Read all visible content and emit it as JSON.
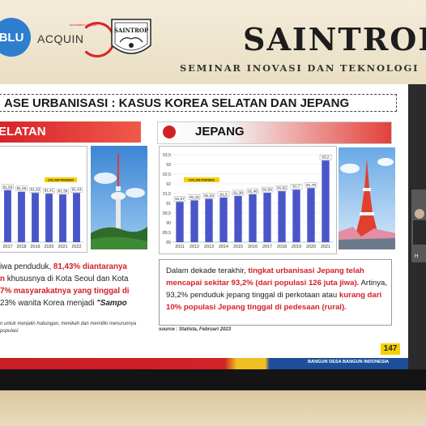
{
  "header": {
    "logo_blu": "BLU",
    "logo_acquin": "ACQUIN",
    "logo_acquin_small": "accredited program",
    "logo_saintrop": "SAINTROP",
    "title": "SAINTROP",
    "subtitle": "SEMINAR INOVASI DAN TEKNOLOGI"
  },
  "slide": {
    "title": "ASE URBANISASI : KASUS KOREA SELATAN DAN JEPANG",
    "left_band_label": "ELATAN",
    "right_band_label": "JEPANG",
    "left_text": {
      "p1": "iwa penduduk, ",
      "p1_red": "81,43% diantaranya",
      "p2_red": "n",
      "p2": " khususnya di Kota Seoul dan Kota",
      "p3_red": "7% masyarakatnya yang tinggal di",
      "p4": " 23% wanita Korea menjadi ",
      "p4_italic": "\"Sampo"
    },
    "left_note": "n untuk menjalin hubungan, menikah dan memiliki menurunnya populasi",
    "right_text": {
      "p1": "Dalam dekade terakhir, ",
      "p1_red": "tingkat urbanisasi Jepang telah mencapai sekitar 93,2% (dari populasi 126 juta jiwa).",
      "p2": " Artinya, 93,2% penduduk jepang tinggal di perkotaan atau ",
      "p2_red": "kurang dari 10% populasi Jepang tinggal di pedesaan (rural)."
    },
    "source": "source : Statista, Februari 2023",
    "page_number": "147",
    "footer_text": "BANGUN DESA BANGUN INDONESIA"
  },
  "video_tile": {
    "label": "H"
  },
  "colors": {
    "bar": "#4a56c8",
    "red": "#d41f26",
    "yellow": "#f6d000",
    "blue": "#1d4e9a"
  },
  "chart_data": [
    {
      "type": "bar",
      "title": "",
      "legend_badge": "DALAM PERSEN",
      "categories": [
        "2017",
        "2018",
        "2019",
        "2020",
        "2021",
        "2022"
      ],
      "values": [
        81.5,
        81.46,
        81.43,
        81.41,
        81.39,
        81.43
      ],
      "data_labels": [
        "81,50",
        "81,46",
        "81,43",
        "81,41",
        "81,39",
        "81,43"
      ],
      "note": "chart partially cropped on the left"
    },
    {
      "type": "bar",
      "title": "",
      "legend_badge": "DALAM PERSEN",
      "categories": [
        "2011",
        "2012",
        "2013",
        "2014",
        "2015",
        "2016",
        "2017",
        "2018",
        "2019",
        "2020",
        "2021"
      ],
      "values": [
        91.07,
        91.15,
        91.23,
        91.3,
        91.38,
        91.46,
        91.54,
        91.62,
        91.7,
        91.78,
        93.2
      ],
      "data_labels": [
        "91,07",
        "91,15",
        "91,23",
        "91,3",
        "91,38",
        "91,46",
        "91,54",
        "91,62",
        "91,7",
        "91,78",
        "93,2"
      ],
      "y_ticks": [
        "89",
        "89,5",
        "90",
        "90,5",
        "91",
        "91,5",
        "92",
        "92,5",
        "93",
        "93,5"
      ],
      "ylim": [
        89,
        93.5
      ]
    }
  ]
}
